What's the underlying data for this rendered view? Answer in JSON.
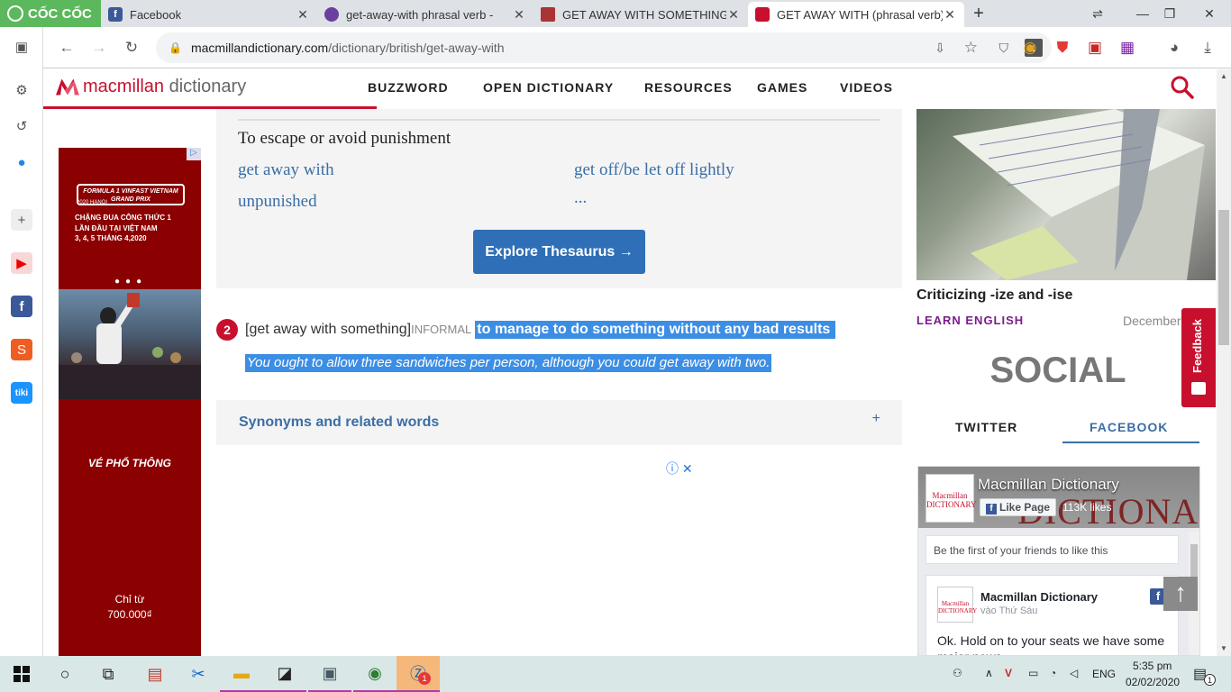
{
  "browser": {
    "brand_label": "CỐC CỐC",
    "tabs": [
      {
        "title": "Facebook",
        "favicon": "facebook-icon",
        "active": false
      },
      {
        "title": "get-away-with phrasal verb -",
        "favicon": "globe-icon",
        "active": false
      },
      {
        "title": "GET AWAY WITH SOMETHING",
        "favicon": "cambridge-icon",
        "active": false
      },
      {
        "title": "GET AWAY WITH (phrasal verb)",
        "favicon": "macmillan-icon",
        "active": true
      }
    ],
    "new_tab_label": "+",
    "url_domain": "macmillandictionary.com",
    "url_path": "/dictionary/british/get-away-with"
  },
  "site": {
    "logo_brand": "macmillan",
    "logo_suffix": "dictionary",
    "nav": [
      "BUZZWORD",
      "OPEN DICTIONARY",
      "RESOURCES",
      "GAMES",
      "VIDEOS"
    ]
  },
  "ad_left": {
    "headline": "FORMULA 1 VINFAST VIETNAM GRAND PRIX",
    "year_city": "2020 HANOI",
    "tagline": "CHẶNG ĐUA CÔNG THỨC 1 LẦN ĐẦU TẠI VIỆT NAM",
    "dates": "3, 4, 5 THÁNG 4,2020",
    "ticket": "VÉ PHỔ THÔNG",
    "price_label": "Chỉ từ",
    "price": "700.000₫"
  },
  "thesaurus": {
    "heading": "To escape or avoid punishment",
    "synonyms": [
      "get away with",
      "get off/be let off lightly",
      "unpunished",
      "..."
    ],
    "button_label": "Explore Thesaurus →"
  },
  "sense": {
    "number": "2",
    "pattern": "[get away with something]",
    "register": "INFORMAL",
    "definition": "to manage to do something without any bad results",
    "example": "You ought to allow three sandwiches per person, although you could get away with two."
  },
  "synonyms_bar": {
    "label": "Synonyms and related words",
    "toggle": "+"
  },
  "right": {
    "article_title": "Criticizing -ize and -ise",
    "article_category": "LEARN ENGLISH",
    "article_date": "December",
    "social_heading": "SOCIAL",
    "social_tabs": [
      "TWITTER",
      "FACEBOOK"
    ],
    "feedback_label": "Feedback"
  },
  "fb_widget": {
    "page_name": "Macmillan Dictionary",
    "like_label": "Like Page",
    "likes": "113K likes",
    "friends_text": "Be the first of your friends to like this",
    "post_author": "Macmillan Dictionary",
    "post_time": "vào Thứ Sáu",
    "post_text": "Ok. Hold on to your seats we have some major news..."
  },
  "taskbar": {
    "time": "5:35 pm",
    "date": "02/02/2020",
    "lang": "ENG",
    "notif_count": "1",
    "app_badge": "1"
  },
  "colors": {
    "brand_red": "#c8102e",
    "link_blue": "#3b6ea5",
    "selection": "#3c8ee5",
    "taskbar": "#dae7e7"
  }
}
